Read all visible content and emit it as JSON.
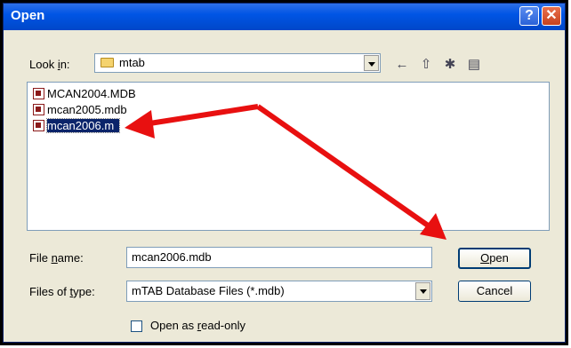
{
  "dialog": {
    "title": "Open",
    "help_glyph": "?",
    "close_glyph": "✕"
  },
  "lookin": {
    "label_pre": "Look ",
    "label_accel": "i",
    "label_post": "n:",
    "folder": "mtab"
  },
  "toolbar": {
    "back_icon": "←",
    "up_icon": "⇧",
    "new_folder_icon": "✱",
    "views_icon": "▤"
  },
  "files": [
    {
      "name": "MCAN2004.MDB",
      "selected": false
    },
    {
      "name": "mcan2005.mdb",
      "selected": false
    },
    {
      "name": "mcan2006.m",
      "selected": true
    }
  ],
  "filename": {
    "label_pre": "File ",
    "label_accel": "n",
    "label_post": "ame:",
    "value": "mcan2006.mdb"
  },
  "filetype": {
    "label_pre": "Files of ",
    "label_accel": "t",
    "label_post": "ype:",
    "value": "mTAB Database Files (*.mdb)"
  },
  "buttons": {
    "open_accel": "O",
    "open_rest": "pen",
    "cancel": "Cancel"
  },
  "readonly": {
    "label_pre": "Open as ",
    "label_accel": "r",
    "label_post": "ead-only"
  },
  "colors": {
    "annotation_arrow": "#e81010",
    "selection": "#0a246a",
    "titlebar": "#0055e5"
  }
}
